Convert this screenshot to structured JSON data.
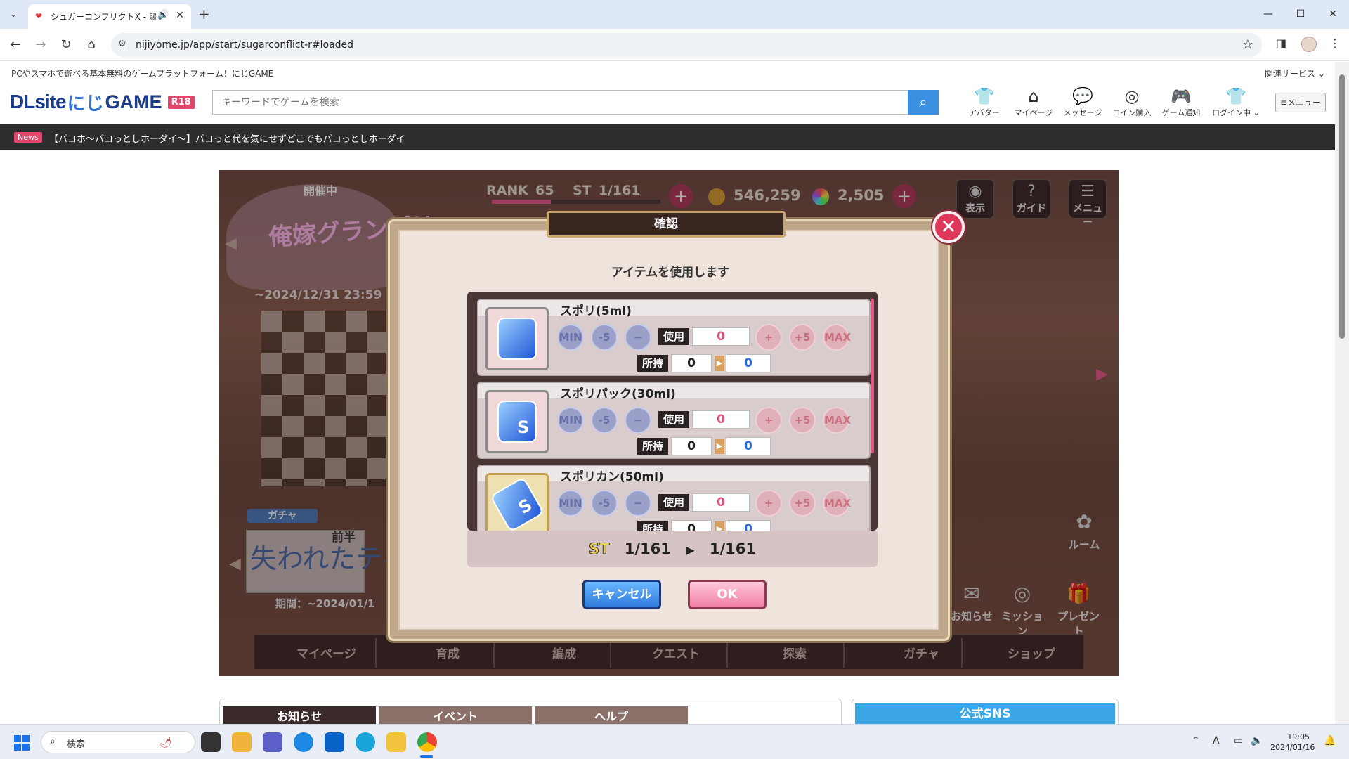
{
  "browser": {
    "tab_title": "シュガーコンフリクトX - 競るセカンド",
    "url": "nijiyome.jp/app/start/sugarconflict-r#loaded",
    "icons": {
      "tab_search": "chevron-down-icon",
      "audio": "speaker-icon",
      "close": "close-icon",
      "new_tab": "plus-icon",
      "back": "arrow-left-icon",
      "forward": "arrow-right-icon",
      "reload": "reload-icon",
      "home": "home-icon",
      "site_info": "tune-icon",
      "bookmark": "star-icon",
      "side_panel": "side-panel-icon",
      "menu": "kebab-icon"
    }
  },
  "site": {
    "tagline": "PCやスマホで遊べる基本無料のゲームプラットフォーム！にじGAME",
    "related_services": "関連サービス",
    "logo": {
      "dl": "DLsite",
      "niji": "にじ",
      "game": "GAME",
      "badge": "R18"
    },
    "search_placeholder": "キーワードでゲームを検索",
    "header_icons": [
      {
        "label": "アバター"
      },
      {
        "label": "マイページ"
      },
      {
        "label": "メッセージ"
      },
      {
        "label": "コイン購入"
      },
      {
        "label": "ゲーム通知"
      },
      {
        "label": "ログイン中"
      }
    ],
    "menu_label": "≡メニュー",
    "news": {
      "badge": "News",
      "text": "【パコホ～パコっとしホーダイ～】パコっと代を気にせずどこでもパコっとしホーダイ"
    }
  },
  "game": {
    "event_status": "開催中",
    "event_title": "俺嫁グランプリ",
    "event_date": "~2024/12/31 23:59",
    "gacha_tag": "ガチャ",
    "gacha_first_half": "前半",
    "gacha_title": "失われたティアラ",
    "gacha_date": "期間：~2024/01/1",
    "status": {
      "rank_label": "RANK",
      "rank": "65",
      "st_label": "ST",
      "st": "1/161",
      "coins": "546,259",
      "gems": "2,505"
    },
    "top_buttons": [
      {
        "label": "表示"
      },
      {
        "label": "ガイド"
      },
      {
        "label": "メニュー"
      }
    ],
    "side_buttons": [
      {
        "label": "ルーム"
      },
      {
        "label": "お知らせ"
      },
      {
        "label": "ミッション"
      },
      {
        "label": "プレゼント"
      }
    ],
    "nav": [
      {
        "label": "マイページ"
      },
      {
        "label": "育成"
      },
      {
        "label": "編成"
      },
      {
        "label": "クエスト"
      },
      {
        "label": "探索"
      },
      {
        "label": "ガチャ"
      },
      {
        "label": "ショップ"
      }
    ]
  },
  "dialog": {
    "title": "確認",
    "subtitle": "アイテムを使用します",
    "controls": {
      "min": "MIN",
      "minus5": "-5",
      "minus": "−",
      "use": "使用",
      "plus": "+",
      "plus5": "+5",
      "max": "MAX",
      "owned": "所持"
    },
    "items": [
      {
        "name": "スポリ(5ml)",
        "use": "0",
        "owned": "0",
        "after": "0"
      },
      {
        "name": "スポリパック(30ml)",
        "use": "0",
        "owned": "0",
        "after": "0"
      },
      {
        "name": "スポリカン(50ml)",
        "use": "0",
        "owned": "0",
        "after": "0"
      }
    ],
    "st": {
      "label": "ST",
      "before": "1/161",
      "after": "1/161"
    },
    "cancel": "キャンセル",
    "ok": "OK"
  },
  "below": {
    "tabs": [
      {
        "label": "お知らせ"
      },
      {
        "label": "イベント"
      },
      {
        "label": "ヘルプ"
      }
    ],
    "sns": "公式SNS"
  },
  "taskbar": {
    "search": "検索",
    "time": "19:05",
    "date": "2024/01/16"
  }
}
